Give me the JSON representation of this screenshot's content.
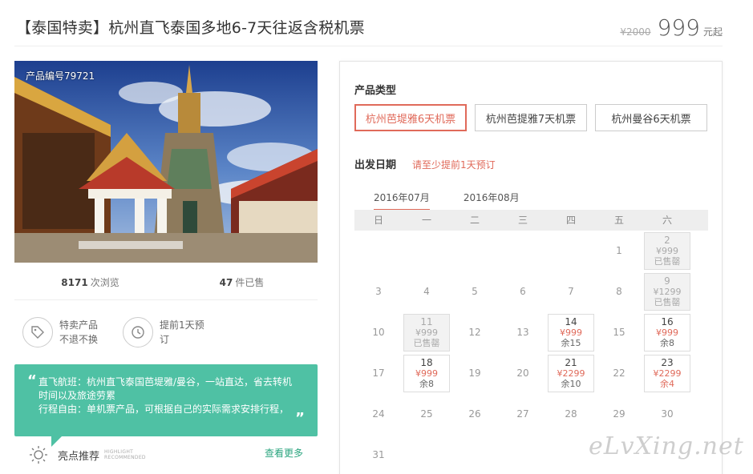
{
  "header": {
    "title": "【泰国特卖】杭州直飞泰国多地6-7天往返含税机票",
    "old_price": "¥2000",
    "price": "999",
    "price_suffix": "元起"
  },
  "photo": {
    "product_no": "产品编号79721"
  },
  "stats": [
    {
      "num": "8171",
      "label": "次浏览"
    },
    {
      "num": "47",
      "label": "件已售"
    }
  ],
  "features": [
    {
      "icon": "tag-icon",
      "line1": "特卖产品",
      "line2": "不退不换"
    },
    {
      "icon": "clock-icon",
      "line1": "提前1天预",
      "line2": "订"
    }
  ],
  "intro": {
    "open_quote": "“",
    "close_quote": "”",
    "line1": "直飞航班：杭州直飞泰国芭堤雅/曼谷，一站直达，省去转机时间以及旅途劳累",
    "line2": "行程自由：单机票产品，可根据自己的实际需求安排行程，"
  },
  "highlight": {
    "icon": "sun-icon",
    "title": "亮点推荐",
    "en1": "HIGHLIGHT",
    "en2": "RECOMMENDED",
    "more": "查看更多"
  },
  "booking": {
    "type_label": "产品类型",
    "types": [
      "杭州芭堤雅6天机票",
      "杭州芭提雅7天机票",
      "杭州曼谷6天机票"
    ],
    "active_type": 0,
    "date_label": "出发日期",
    "date_note": "请至少提前1天预订",
    "months": [
      "2016年07月",
      "2016年08月"
    ],
    "active_month": 0,
    "weekdays": [
      "日",
      "一",
      "二",
      "三",
      "四",
      "五",
      "六"
    ],
    "days": [
      {
        "d": ""
      },
      {
        "d": ""
      },
      {
        "d": ""
      },
      {
        "d": ""
      },
      {
        "d": ""
      },
      {
        "d": "1"
      },
      {
        "d": "2",
        "price": "¥999",
        "status": "已售罄",
        "state": "sold"
      },
      {
        "d": "3"
      },
      {
        "d": "4"
      },
      {
        "d": "5"
      },
      {
        "d": "6"
      },
      {
        "d": "7"
      },
      {
        "d": "8"
      },
      {
        "d": "9",
        "price": "¥1299",
        "status": "已售罄",
        "state": "sold"
      },
      {
        "d": "10"
      },
      {
        "d": "11",
        "price": "¥999",
        "status": "已售罄",
        "state": "sold"
      },
      {
        "d": "12"
      },
      {
        "d": "13"
      },
      {
        "d": "14",
        "price": "¥999",
        "status": "余15",
        "state": "avail"
      },
      {
        "d": "15"
      },
      {
        "d": "16",
        "price": "¥999",
        "status": "余8",
        "state": "avail"
      },
      {
        "d": "17"
      },
      {
        "d": "18",
        "price": "¥999",
        "status": "余8",
        "state": "avail"
      },
      {
        "d": "19"
      },
      {
        "d": "20"
      },
      {
        "d": "21",
        "price": "¥2299",
        "status": "余10",
        "state": "avail"
      },
      {
        "d": "22"
      },
      {
        "d": "23",
        "price": "¥2299",
        "status": "余4",
        "state": "avail",
        "low": true
      },
      {
        "d": "24"
      },
      {
        "d": "25"
      },
      {
        "d": "26"
      },
      {
        "d": "27"
      },
      {
        "d": "28"
      },
      {
        "d": "29"
      },
      {
        "d": "30"
      },
      {
        "d": "31"
      }
    ]
  },
  "watermark": "eLvXing.net"
}
